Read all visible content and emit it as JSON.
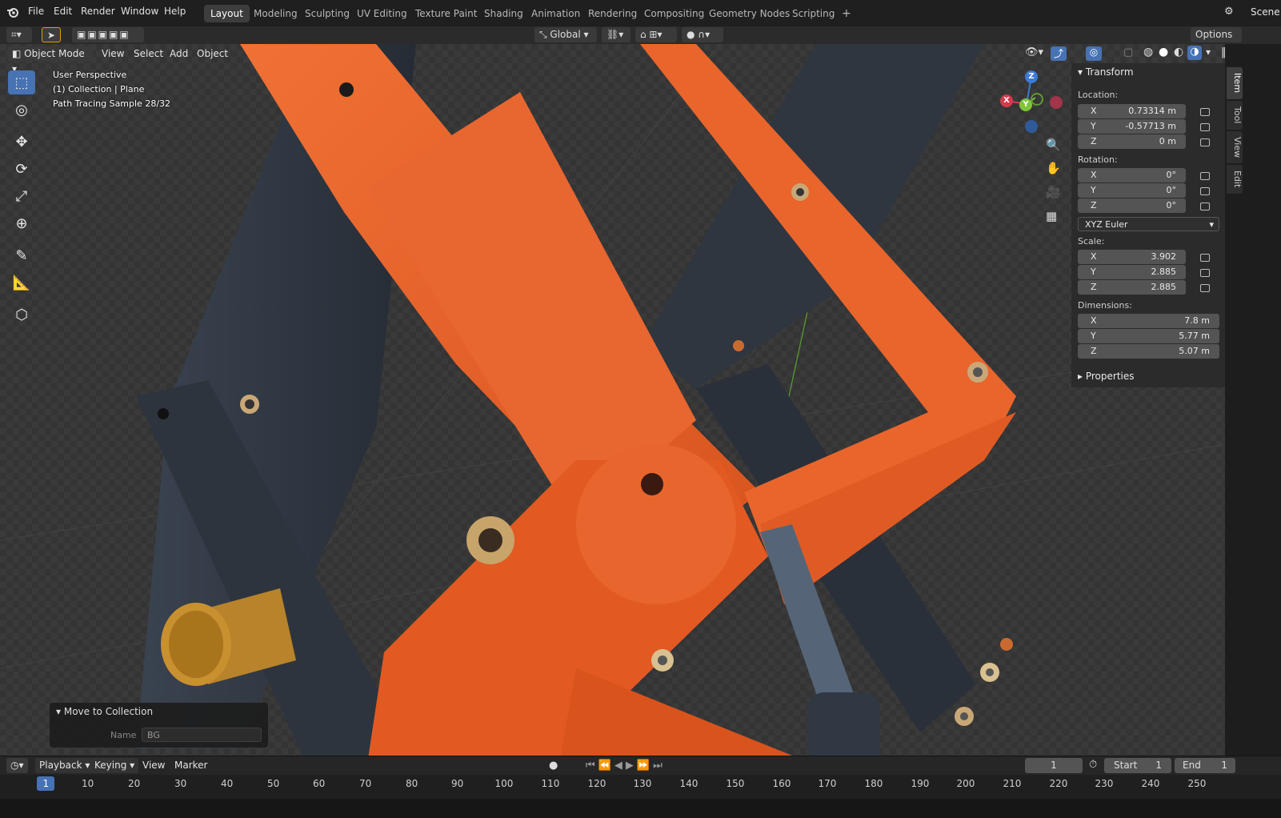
{
  "menubar": {
    "items": [
      "File",
      "Edit",
      "Render",
      "Window",
      "Help"
    ],
    "workspaces": [
      "Layout",
      "Modeling",
      "Sculpting",
      "UV Editing",
      "Texture Paint",
      "Shading",
      "Animation",
      "Rendering",
      "Compositing",
      "Geometry Nodes",
      "Scripting"
    ],
    "add_tab": "+",
    "scene_label": "Scene"
  },
  "toolbar": {
    "orientation": "Global",
    "options": "Options"
  },
  "viewport_header": {
    "mode": "Object Mode",
    "items": [
      "View",
      "Select",
      "Add",
      "Object"
    ]
  },
  "overlay": {
    "line1": "User Perspective",
    "line2": "(1) Collection | Plane",
    "line3": "Path Tracing Sample 28/32"
  },
  "gizmo": {
    "x": "X",
    "y": "Y",
    "z": "Z"
  },
  "npanel": {
    "title": "Transform",
    "location_label": "Location:",
    "location": [
      {
        "axis": "X",
        "value": "0.73314 m"
      },
      {
        "axis": "Y",
        "value": "-0.57713 m"
      },
      {
        "axis": "Z",
        "value": "0 m"
      }
    ],
    "rotation_label": "Rotation:",
    "rotation": [
      {
        "axis": "X",
        "value": "0°"
      },
      {
        "axis": "Y",
        "value": "0°"
      },
      {
        "axis": "Z",
        "value": "0°"
      }
    ],
    "rotation_mode": "XYZ Euler",
    "scale_label": "Scale:",
    "scale": [
      {
        "axis": "X",
        "value": "3.902"
      },
      {
        "axis": "Y",
        "value": "2.885"
      },
      {
        "axis": "Z",
        "value": "2.885"
      }
    ],
    "dimensions_label": "Dimensions:",
    "dimensions": [
      {
        "axis": "X",
        "value": "7.8 m"
      },
      {
        "axis": "Y",
        "value": "5.77 m"
      },
      {
        "axis": "Z",
        "value": "5.07 m"
      }
    ],
    "properties": "Properties"
  },
  "side_tabs": [
    "Item",
    "Tool",
    "View",
    "Edit"
  ],
  "operator_panel": {
    "title": "Move to Collection",
    "name_label": "Name",
    "name_value": "BG"
  },
  "timeline": {
    "menus": [
      "Playback",
      "Keying",
      "View",
      "Marker"
    ],
    "current_frame": "1",
    "start_label": "Start",
    "start_value": "1",
    "end_label": "End",
    "end_value": "1",
    "ticks": [
      "1",
      "10",
      "20",
      "30",
      "40",
      "50",
      "60",
      "70",
      "80",
      "90",
      "100",
      "110",
      "120",
      "130",
      "140",
      "150",
      "160",
      "170",
      "180",
      "190",
      "200",
      "210",
      "220",
      "230",
      "240",
      "250"
    ]
  },
  "colors": {
    "accent": "#4772b3",
    "orange": "#e8602a",
    "dark_bar": "#2f3640"
  }
}
